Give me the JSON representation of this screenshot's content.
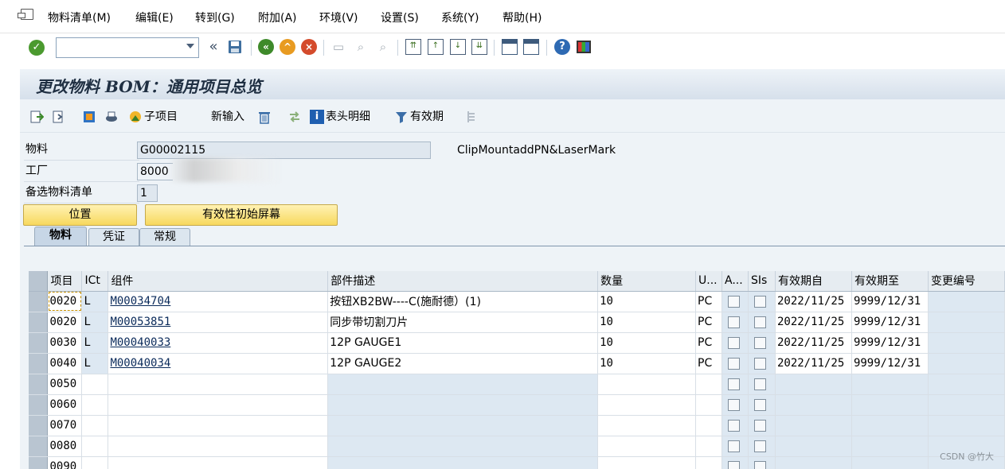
{
  "menu": [
    "物料清单(M)",
    "编辑(E)",
    "转到(G)",
    "附加(A)",
    "环境(V)",
    "设置(S)",
    "系统(Y)",
    "帮助(H)"
  ],
  "toolbar": {
    "command_value": "",
    "back_glyph": "«"
  },
  "title": "更改物料 BOM：通用项目总览",
  "app_toolbar": {
    "subitem": "子项目",
    "new_entry": "新输入",
    "header_detail": "表头明细",
    "validity": "有效期"
  },
  "header": {
    "material_label": "物料",
    "material_value": "G00002115",
    "material_desc": "ClipMountaddPN&LaserMark",
    "plant_label": "工厂",
    "plant_value": "8000",
    "alt_bom_label": "备选物料清单",
    "alt_bom_value": "1"
  },
  "buttons": {
    "position": "位置",
    "validity_initial": "有效性初始屏幕"
  },
  "tabs": [
    "物料",
    "凭证",
    "常规"
  ],
  "table": {
    "columns": [
      "项目",
      "ICt",
      "组件",
      "部件描述",
      "数量",
      "U...",
      "A...",
      "SIs",
      "有效期自",
      "有效期至",
      "变更编号"
    ],
    "rows": [
      {
        "item": "0020",
        "ict": "L",
        "component": "M00034704",
        "desc": "按钮XB2BW----C(施耐德）(1)",
        "qty": "10",
        "unit": "PC",
        "valid_from": "2022/11/25",
        "valid_to": "9999/12/31",
        "change": ""
      },
      {
        "item": "0020",
        "ict": "L",
        "component": "M00053851",
        "desc": "同步带切割刀片",
        "qty": "10",
        "unit": "PC",
        "valid_from": "2022/11/25",
        "valid_to": "9999/12/31",
        "change": ""
      },
      {
        "item": "0030",
        "ict": "L",
        "component": "M00040033",
        "desc": "12P GAUGE1",
        "qty": "10",
        "unit": "PC",
        "valid_from": "2022/11/25",
        "valid_to": "9999/12/31",
        "change": ""
      },
      {
        "item": "0040",
        "ict": "L",
        "component": "M00040034",
        "desc": "12P GAUGE2",
        "qty": "10",
        "unit": "PC",
        "valid_from": "2022/11/25",
        "valid_to": "9999/12/31",
        "change": ""
      },
      {
        "item": "0050",
        "ict": "",
        "component": "",
        "desc": "",
        "qty": "",
        "unit": "",
        "valid_from": "",
        "valid_to": "",
        "change": ""
      },
      {
        "item": "0060",
        "ict": "",
        "component": "",
        "desc": "",
        "qty": "",
        "unit": "",
        "valid_from": "",
        "valid_to": "",
        "change": ""
      },
      {
        "item": "0070",
        "ict": "",
        "component": "",
        "desc": "",
        "qty": "",
        "unit": "",
        "valid_from": "",
        "valid_to": "",
        "change": ""
      },
      {
        "item": "0080",
        "ict": "",
        "component": "",
        "desc": "",
        "qty": "",
        "unit": "",
        "valid_from": "",
        "valid_to": "",
        "change": ""
      },
      {
        "item": "0090",
        "ict": "",
        "component": "",
        "desc": "",
        "qty": "",
        "unit": "",
        "valid_from": "",
        "valid_to": "",
        "change": ""
      }
    ]
  },
  "watermark": "CSDN @竹大"
}
